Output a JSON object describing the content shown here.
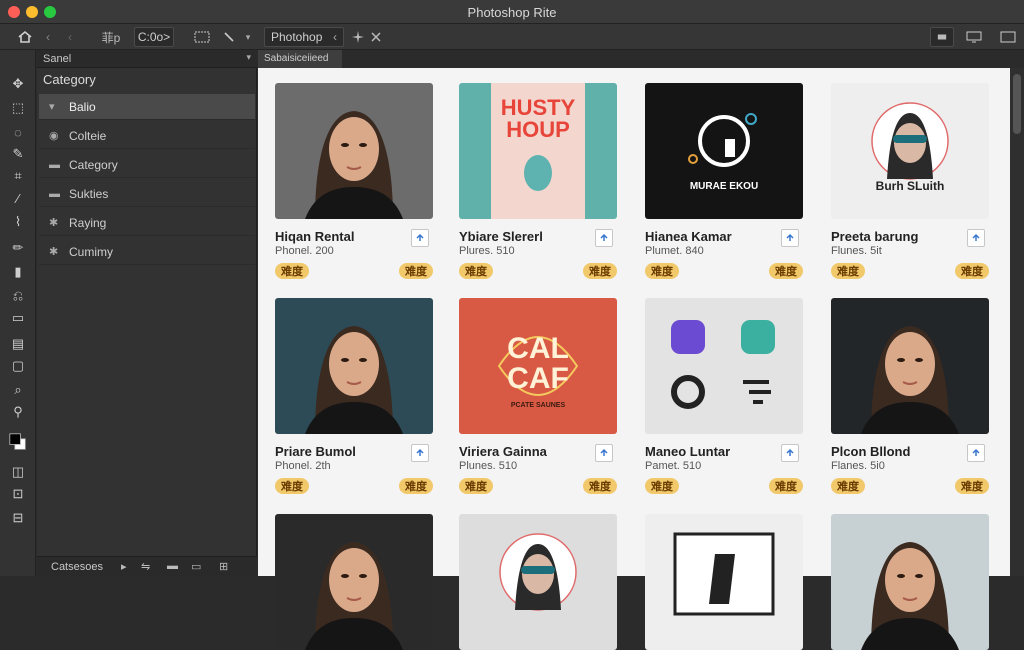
{
  "window": {
    "title": "Photoshop Rite",
    "traffic_colors": [
      "#ff5f57",
      "#febc2e",
      "#28c840"
    ]
  },
  "toolbar": {
    "home_icon": "home-icon",
    "nav_back": "‹",
    "nav_forward": "‹",
    "field_left": "菲p",
    "field_value": "C:0o>",
    "app_label": "Photohop",
    "app_chevron": "‹"
  },
  "left_panel": {
    "tab_label": "Sanel",
    "heading": "Category",
    "items": [
      {
        "icon": "chevron-icon",
        "glyph": "▾",
        "label": "Balio",
        "active": true
      },
      {
        "icon": "eye-icon",
        "glyph": "◉",
        "label": "Colteie",
        "active": false
      },
      {
        "icon": "folder-icon",
        "glyph": "▬",
        "label": "Category",
        "active": false
      },
      {
        "icon": "folder-icon",
        "glyph": "▬",
        "label": "Sukties",
        "active": false
      },
      {
        "icon": "gear-icon",
        "glyph": "✱",
        "label": "Raying",
        "active": false
      },
      {
        "icon": "gear-icon",
        "glyph": "✱",
        "label": "Cumimy",
        "active": false
      }
    ],
    "footer_label": "Catsesoes"
  },
  "document": {
    "tab_label": "Sabaisiceiieed"
  },
  "cards": [
    {
      "title": "Hiqan Rental",
      "sub": "Phonel. 200",
      "badge": "难度",
      "thumb_bg": "#6c6c6c",
      "thumb_type": "portrait"
    },
    {
      "title": "Ybiare Slererl",
      "sub": "Plures. 510",
      "badge": "难度",
      "thumb_bg": "#5fb1aa",
      "thumb_type": "poster",
      "poster_line1": "HUSTY",
      "poster_line2": "HOUP"
    },
    {
      "title": "Hianea Kamar",
      "sub": "Plumet. 840",
      "badge": "难度",
      "thumb_bg": "#141414",
      "thumb_type": "logo",
      "logo_text": "MURAE EKOU"
    },
    {
      "title": "Preeta barung",
      "sub": "Flunes. 5it",
      "badge": "难度",
      "thumb_bg": "#eeeeee",
      "thumb_type": "avatar",
      "avatar_text": "Burh SLuith"
    },
    {
      "title": "Priare Bumol",
      "sub": "Phonel. 2th",
      "badge": "难度",
      "thumb_bg": "#2d4b57",
      "thumb_type": "portrait"
    },
    {
      "title": "Viriera Gainna",
      "sub": "Plunes. 510",
      "badge": "难度",
      "thumb_bg": "#d85a44",
      "thumb_type": "poster2",
      "poster_line1": "CAL",
      "poster_line2": "CAF",
      "poster_small": "PCATE SAUNES"
    },
    {
      "title": "Maneo Luntar",
      "sub": "Pamet. 510",
      "badge": "难度",
      "thumb_bg": "#e3e3e3",
      "thumb_type": "icons"
    },
    {
      "title": "Plcon Bllond",
      "sub": "Flanes. 5i0",
      "badge": "难度",
      "thumb_bg": "#222629",
      "thumb_type": "portrait"
    },
    {
      "title": "",
      "sub": "",
      "badge": "",
      "thumb_bg": "#2a2a2a",
      "thumb_type": "portrait"
    },
    {
      "title": "",
      "sub": "",
      "badge": "",
      "thumb_bg": "#dddddd",
      "thumb_type": "avatar2"
    },
    {
      "title": "",
      "sub": "",
      "badge": "",
      "thumb_bg": "#eeeeee",
      "thumb_type": "device"
    },
    {
      "title": "",
      "sub": "",
      "badge": "",
      "thumb_bg": "#c7d0d2",
      "thumb_type": "portrait"
    }
  ]
}
